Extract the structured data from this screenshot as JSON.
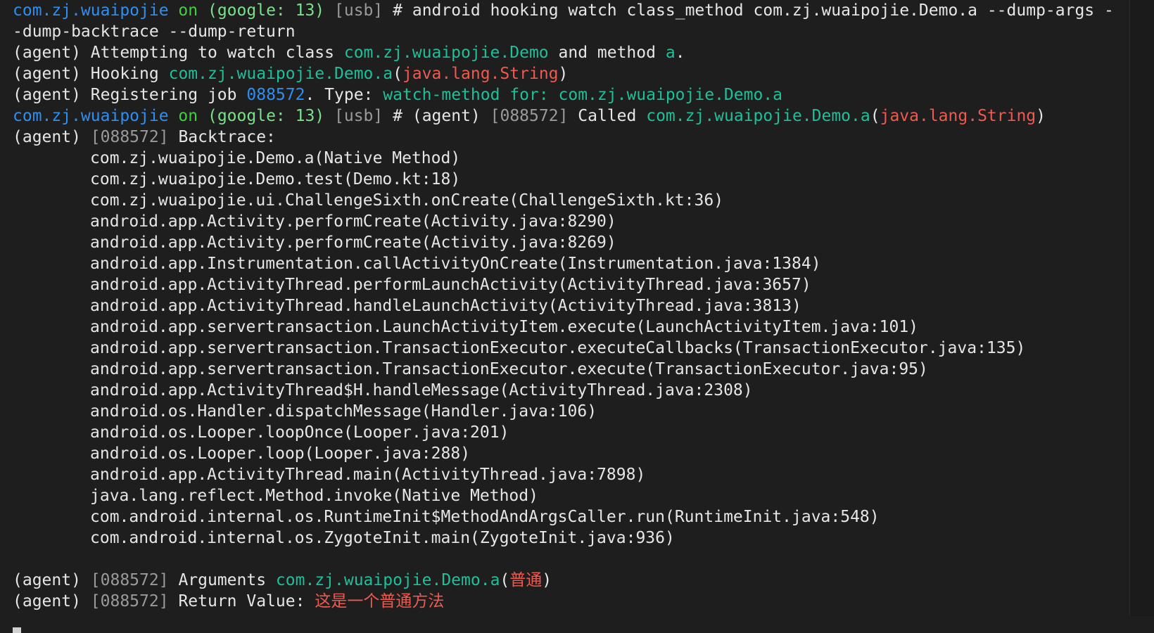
{
  "prompt": {
    "pkg": "com.zj.wuaipojie",
    "on": "on",
    "device": "(google: 13)",
    "conn": "[usb]",
    "hash": "#"
  },
  "command": {
    "line1": "android hooking watch class_method com.zj.wuaipojie.Demo.a --dump-args -",
    "line2": "-dump-backtrace --dump-return"
  },
  "agent": "(agent)",
  "attempt": {
    "prefix": "Attempting to watch class",
    "cls": "com.zj.wuaipojie.Demo",
    "mid": "and method",
    "method": "a",
    "end": "."
  },
  "hooking": {
    "label": "Hooking",
    "cls": "com.zj.wuaipojie.Demo",
    "dot_a": ".a",
    "open": "(",
    "arg": "java.lang.String",
    "close": ")"
  },
  "register": {
    "label": "Registering job",
    "job": "088572",
    "type_label": ". Type:",
    "type": "watch-method for: com.zj.wuaipojie.Demo.a"
  },
  "called": {
    "job": "[088572]",
    "label": "Called",
    "cls": "com.zj.wuaipojie.Demo",
    "dot_a": ".a",
    "open": "(",
    "arg": "java.lang.String",
    "close": ")"
  },
  "backtrace": {
    "job": "[088572]",
    "label": "Backtrace:",
    "frames": [
      "com.zj.wuaipojie.Demo.a(Native Method)",
      "com.zj.wuaipojie.Demo.test(Demo.kt:18)",
      "com.zj.wuaipojie.ui.ChallengeSixth.onCreate(ChallengeSixth.kt:36)",
      "android.app.Activity.performCreate(Activity.java:8290)",
      "android.app.Activity.performCreate(Activity.java:8269)",
      "android.app.Instrumentation.callActivityOnCreate(Instrumentation.java:1384)",
      "android.app.ActivityThread.performLaunchActivity(ActivityThread.java:3657)",
      "android.app.ActivityThread.handleLaunchActivity(ActivityThread.java:3813)",
      "android.app.servertransaction.LaunchActivityItem.execute(LaunchActivityItem.java:101)",
      "android.app.servertransaction.TransactionExecutor.executeCallbacks(TransactionExecutor.java:135)",
      "android.app.servertransaction.TransactionExecutor.execute(TransactionExecutor.java:95)",
      "android.app.ActivityThread$H.handleMessage(ActivityThread.java:2308)",
      "android.os.Handler.dispatchMessage(Handler.java:106)",
      "android.os.Looper.loopOnce(Looper.java:201)",
      "android.os.Looper.loop(Looper.java:288)",
      "android.app.ActivityThread.main(ActivityThread.java:7898)",
      "java.lang.reflect.Method.invoke(Native Method)",
      "com.android.internal.os.RuntimeInit$MethodAndArgsCaller.run(RuntimeInit.java:548)",
      "com.android.internal.os.ZygoteInit.main(ZygoteInit.java:936)"
    ]
  },
  "arguments": {
    "job": "[088572]",
    "label": "Arguments",
    "cls": "com.zj.wuaipojie.Demo",
    "dot_a": ".a",
    "open": "(",
    "arg": "普通",
    "close": ")"
  },
  "return_value": {
    "job": "[088572]",
    "label": "Return Value:",
    "value": "这是一个普通方法"
  }
}
